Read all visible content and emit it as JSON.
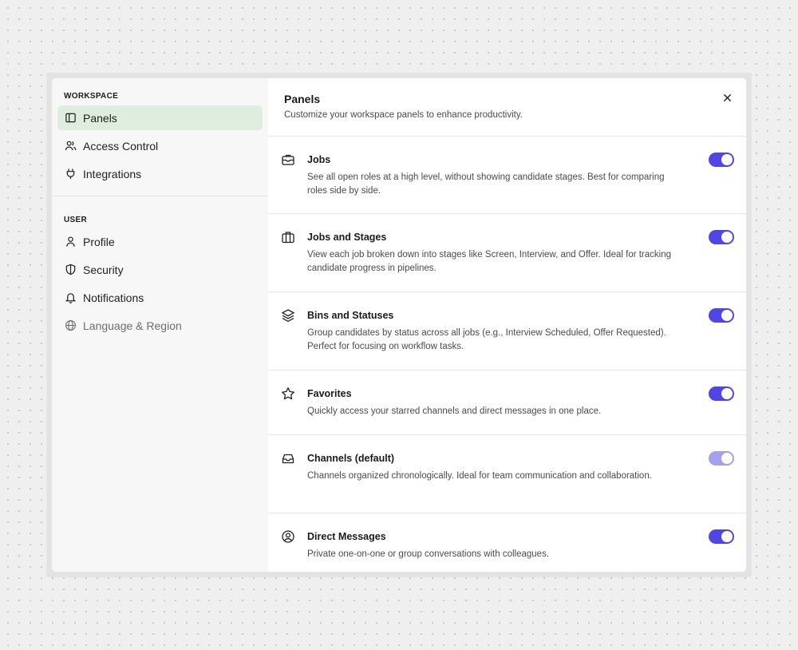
{
  "sidebar": {
    "workspace_title": "WORKSPACE",
    "workspace_items": [
      {
        "label": "Panels",
        "icon": "panel-icon"
      },
      {
        "label": "Access Control",
        "icon": "users-icon"
      },
      {
        "label": "Integrations",
        "icon": "plug-icon"
      }
    ],
    "user_title": "USER",
    "user_items": [
      {
        "label": "Profile",
        "icon": "user-icon"
      },
      {
        "label": "Security",
        "icon": "shield-icon"
      },
      {
        "label": "Notifications",
        "icon": "bell-icon"
      },
      {
        "label": "Language & Region",
        "icon": "globe-icon"
      }
    ]
  },
  "main": {
    "title": "Panels",
    "subtitle": "Customize your workspace panels to enhance productivity.",
    "close_icon": "close-icon",
    "panels": [
      {
        "title": "Jobs",
        "description": "See all open roles at a high level, without showing candidate stages. Best for comparing roles side by side.",
        "icon": "inbox-briefcase-icon",
        "enabled": true
      },
      {
        "title": "Jobs and Stages",
        "description": "View each job broken down into stages like Screen, Interview, and Offer. Ideal for tracking candidate progress in pipelines.",
        "icon": "briefcase-icon",
        "enabled": true
      },
      {
        "title": "Bins and Statuses",
        "description": "Group candidates by status across all jobs (e.g., Interview Scheduled, Offer Requested). Perfect for focusing on workflow tasks.",
        "icon": "layers-icon",
        "enabled": true
      },
      {
        "title": "Favorites",
        "description": "Quickly access your starred channels and direct messages in one place.",
        "icon": "star-icon",
        "enabled": true
      },
      {
        "title": "Channels (default)",
        "description": "Channels organized chronologically. Ideal for team communication and collaboration.",
        "icon": "tray-icon",
        "enabled": true,
        "disabled_look": true
      },
      {
        "title": "Direct Messages",
        "description": "Private one-on-one or group conversations with colleagues.",
        "icon": "user-circle-icon",
        "enabled": true
      }
    ]
  },
  "colors": {
    "accent": "#4f46e5",
    "accent_light": "#a5a0ec",
    "active_item_bg": "#deedde"
  }
}
